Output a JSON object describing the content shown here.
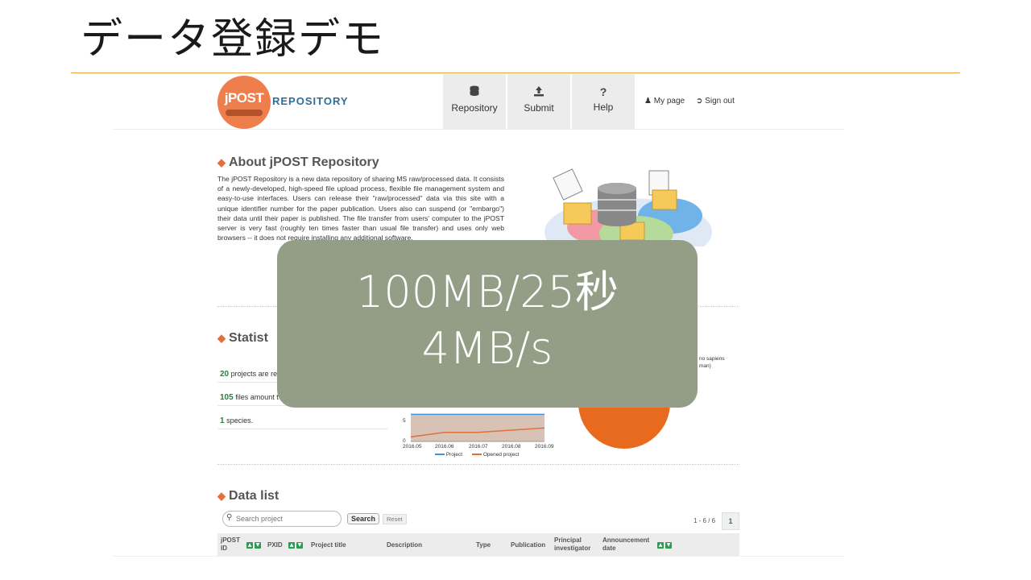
{
  "slide": {
    "title": "データ登録デモ"
  },
  "header": {
    "logo_text": "jPOST",
    "logo_word": "REPOSITORY",
    "nav": [
      {
        "icon": "database-icon",
        "label": "Repository"
      },
      {
        "icon": "upload-icon",
        "label": "Submit"
      },
      {
        "icon": "help-icon",
        "label": "Help"
      }
    ],
    "my_page": "My page",
    "sign_out": "Sign out"
  },
  "about": {
    "title": "About jPOST Repository",
    "text": "The jPOST Repository is a new data repository of sharing MS raw/processed data. It consists of a newly-developed, high-speed file upload process, flexible file management system and easy-to-use interfaces. Users can release their \"raw/processed\" data via this site with a unique identifier number for the paper publication. Users also can suspend (or \"embargo\") their data until their paper is published. The file transfer from users' computer to the jPOST server is very fast (roughly ten times faster than usual file transfer) and uses only web browsers -- it does not require installing any additional software."
  },
  "statistics": {
    "title": "Statist",
    "rows": [
      {
        "num": "20",
        "text": "projects are re"
      },
      {
        "num": "105",
        "text": "files amount t"
      },
      {
        "num": "1",
        "text": "species."
      }
    ],
    "pie_label_line1": "no sapiens",
    "pie_label_line2": "man)"
  },
  "chart_data": {
    "type": "line",
    "x": [
      "2016.05",
      "2016.06",
      "2016.07",
      "2016.08",
      "2016.09"
    ],
    "y_ticks_visible": [
      "5",
      "0"
    ],
    "series": [
      {
        "name": "Project",
        "values": [
          12,
          12,
          12,
          12,
          12
        ],
        "color": "#4a90d9"
      },
      {
        "name": "Opened project",
        "values": [
          2,
          4,
          4,
          5,
          6
        ],
        "color": "#e0703a"
      }
    ],
    "ylim": [
      0,
      20
    ]
  },
  "datalist": {
    "title": "Data list",
    "search_placeholder": "Search project",
    "search_button": "Search",
    "reset_button": "Reset",
    "page_info": "1 - 6 / 6",
    "current_page": "1",
    "columns": [
      {
        "line1": "jPOST",
        "line2": "ID"
      },
      {
        "line1": "PXID",
        "line2": ""
      },
      {
        "line1": "Project title",
        "line2": ""
      },
      {
        "line1": "Description",
        "line2": ""
      },
      {
        "line1": "Type",
        "line2": ""
      },
      {
        "line1": "Publication",
        "line2": ""
      },
      {
        "line1": "Principal",
        "line2": "investigator"
      },
      {
        "line1": "Announcement",
        "line2": "date"
      }
    ]
  },
  "overlay": {
    "line1": "100MB/25秒",
    "line2": "4MB/s"
  },
  "colors": {
    "accent_rule": "#e8a33d",
    "logo_orange": "#ee7f4d",
    "overlay_bg": "#949e86",
    "pie_orange": "#e86a1f",
    "stat_green": "#2d7d3f"
  }
}
